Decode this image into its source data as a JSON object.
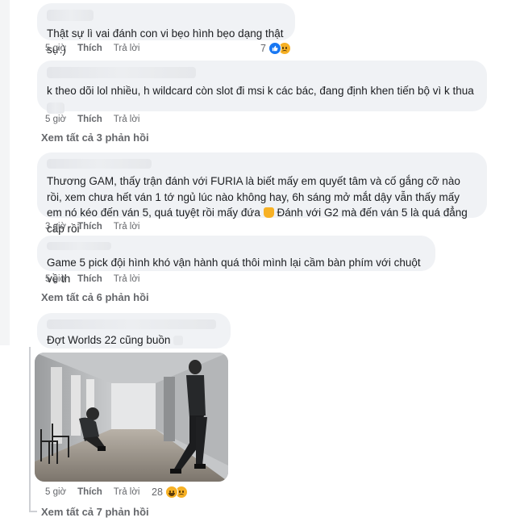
{
  "comments": [
    {
      "text": "Thật sự lì vai đánh con vi bẹo hình bẹo dạng thật sự:)",
      "time": "5 giờ",
      "like": "Thích",
      "reply": "Trả lời",
      "reaction_count": "7"
    },
    {
      "text": "k theo dõi lol nhiều, h wildcard còn slot đi msi k các bác, đang định khen tiến bộ vì k thua",
      "time": "5 giờ",
      "like": "Thích",
      "reply": "Trả lời"
    },
    {
      "text": "Thương GAM, thấy trận đánh với FURIA là biết mấy em quyết tâm và cố gắng cỡ nào rồi, xem chưa hết ván 1 tớ ngủ lúc nào không hay, 6h sáng mở mắt dậy vẫn thấy mấy em nó kéo đến ván 5, quá tuyệt rồi mấy đứa",
      "text2": "Đánh với G2 mà đến ván 5 là quá đẳng cấp rồi",
      "time": "3 giờ",
      "like": "Thích",
      "reply": "Trả lời"
    },
    {
      "text": "Game 5 pick đội hình khó vận hành quá thôi mình lại cầm bàn phím với chuột về th",
      "time": "5 giờ",
      "like": "Thích",
      "reply": "Trả lời"
    },
    {
      "text": "Đợt Worlds 22 cũng buồn",
      "time": "5 giờ",
      "like": "Thích",
      "reply": "Trả lời",
      "reaction_count": "28"
    }
  ],
  "see_more": [
    "Xem tất cả 3 phản hồi",
    "Xem tất cả 6 phản hồi",
    "Xem tất cả 7 phản hồi"
  ],
  "icons": {
    "like": "like-reaction-icon",
    "sad": "sad-reaction-icon",
    "haha": "haha-reaction-icon",
    "thumbs_up_emoji": "thumbs-up-emoji"
  },
  "colors": {
    "bubble": "#f0f2f5",
    "meta": "#65676b",
    "like_blue": "#1877f2",
    "emoji_yellow": "#f7b125"
  }
}
